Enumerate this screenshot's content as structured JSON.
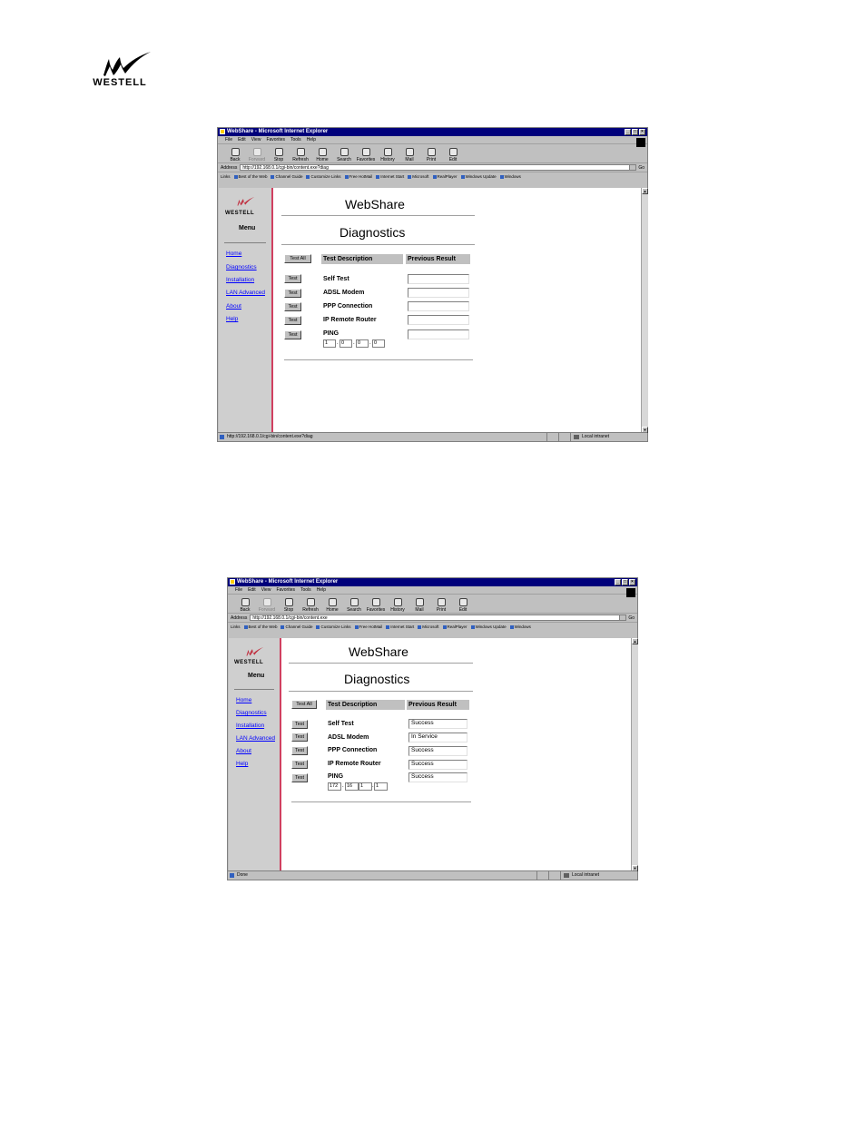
{
  "logo": {
    "brand": "WESTELL"
  },
  "screens": [
    {
      "window_title": "WebShare - Microsoft Internet Explorer",
      "menu": [
        "File",
        "Edit",
        "View",
        "Favorites",
        "Tools",
        "Help"
      ],
      "toolbar": [
        "Back",
        "Forward",
        "Stop",
        "Refresh",
        "Home",
        "Search",
        "Favorites",
        "History",
        "Mail",
        "Print",
        "Edit"
      ],
      "address_label": "Address",
      "address": "http://192.168.0.1/cgi-bin/content.exe?diag",
      "go_label": "Go",
      "links_label": "Links",
      "links": [
        "Best of the Web",
        "Channel Guide",
        "Customize Links",
        "Free HotMail",
        "Internet Start",
        "Microsoft",
        "RealPlayer",
        "Windows Update",
        "Windows"
      ],
      "sidebar": {
        "logo": "WESTELL",
        "menu_title": "Menu",
        "items": [
          "Home",
          "Diagnostics",
          "Installation",
          "LAN Advanced",
          "About",
          "Help"
        ]
      },
      "heading": "WebShare",
      "subheading": "Diagnostics",
      "test_all_label": "Test All",
      "col_desc": "Test Description",
      "col_result": "Previous Result",
      "test_label": "Test",
      "tests": [
        {
          "name": "Self Test",
          "result": ""
        },
        {
          "name": "ADSL Modem",
          "result": ""
        },
        {
          "name": "PPP Connection",
          "result": ""
        },
        {
          "name": "IP Remote Router",
          "result": ""
        },
        {
          "name": "PING",
          "result": ""
        }
      ],
      "ping_ip": [
        "1",
        "0",
        "0",
        "0"
      ],
      "status_text": "http://192.168.0.1/cgi-bin/content.exe?diag",
      "zone": "Local intranet"
    },
    {
      "window_title": "WebShare - Microsoft Internet Explorer",
      "menu": [
        "File",
        "Edit",
        "View",
        "Favorites",
        "Tools",
        "Help"
      ],
      "toolbar": [
        "Back",
        "Forward",
        "Stop",
        "Refresh",
        "Home",
        "Search",
        "Favorites",
        "History",
        "Mail",
        "Print",
        "Edit"
      ],
      "address_label": "Address",
      "address": "http://192.168.0.1/cgi-bin/content.exe",
      "go_label": "Go",
      "links_label": "Links",
      "links": [
        "Best of the Web",
        "Channel Guide",
        "Customize Links",
        "Free HotMail",
        "Internet Start",
        "Microsoft",
        "RealPlayer",
        "Windows Update",
        "Windows"
      ],
      "sidebar": {
        "logo": "WESTELL",
        "menu_title": "Menu",
        "items": [
          "Home",
          "Diagnostics",
          "Installation",
          "LAN Advanced",
          "About",
          "Help"
        ]
      },
      "heading": "WebShare",
      "subheading": "Diagnostics",
      "test_all_label": "Test All",
      "col_desc": "Test Description",
      "col_result": "Previous Result",
      "test_label": "Test",
      "tests": [
        {
          "name": "Self Test",
          "result": "Success"
        },
        {
          "name": "ADSL Modem",
          "result": "In Service"
        },
        {
          "name": "PPP Connection",
          "result": "Success"
        },
        {
          "name": "IP Remote Router",
          "result": "Success"
        },
        {
          "name": "PING",
          "result": "Success"
        }
      ],
      "ping_ip": [
        "172",
        "16",
        "1",
        "1"
      ],
      "status_text": "Done",
      "zone": "Local intranet"
    }
  ]
}
